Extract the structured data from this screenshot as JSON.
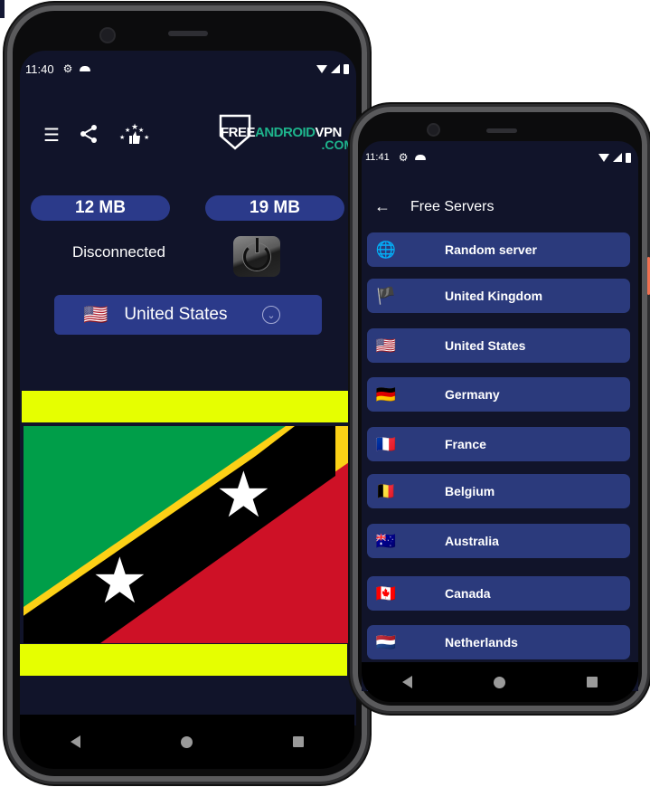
{
  "left_phone": {
    "status_bar": {
      "time": "11:40",
      "left_icons": [
        "gear-icon",
        "cloud-icon"
      ],
      "right_icons": [
        "wifi-icon",
        "signal-icon",
        "battery-icon"
      ]
    },
    "toolbar": {
      "icons": [
        "list-icon",
        "share-icon",
        "rate-stars-icon"
      ]
    },
    "logo": {
      "free": "FREE",
      "android": "ANDROID",
      "vpn": "VPN",
      "com": ".COM"
    },
    "traffic": {
      "download": "12 MB",
      "upload": "19 MB"
    },
    "connection_status": "Disconnected",
    "power_button": {
      "icon": "power-icon"
    },
    "country_select": {
      "flag": "🇺🇸",
      "country": "United States",
      "icon": "chevron-down-circle-icon"
    },
    "banner": {
      "country_flag": "Saint Kitts and Nevis",
      "colors": {
        "green": "#009e49",
        "yellow": "#fcd116",
        "black": "#000000",
        "red": "#ce1126",
        "banner_bg": "#e6ff00"
      }
    },
    "nav": [
      "back",
      "home",
      "recents"
    ]
  },
  "right_phone": {
    "status_bar": {
      "time": "11:41"
    },
    "header": {
      "back_icon": "←",
      "title": "Free Servers"
    },
    "servers": [
      {
        "flag": "🌐",
        "name": "Random server"
      },
      {
        "flag": "🏴",
        "name": "United Kingdom"
      },
      {
        "flag": "🇺🇸",
        "name": "United States"
      },
      {
        "flag": "🇩🇪",
        "name": "Germany"
      },
      {
        "flag": "🇫🇷",
        "name": "France"
      },
      {
        "flag": "🇧🇪",
        "name": "Belgium"
      },
      {
        "flag": "🇦🇺",
        "name": "Australia"
      },
      {
        "flag": "🇨🇦",
        "name": "Canada"
      },
      {
        "flag": "🇳🇱",
        "name": "Netherlands"
      },
      {
        "flag": "",
        "name": ""
      }
    ]
  },
  "colors": {
    "screen_bg": "#11142a",
    "accent": "#2b3a8a",
    "list_item": "#2b3a7c",
    "logo_green": "#1eb48c"
  }
}
